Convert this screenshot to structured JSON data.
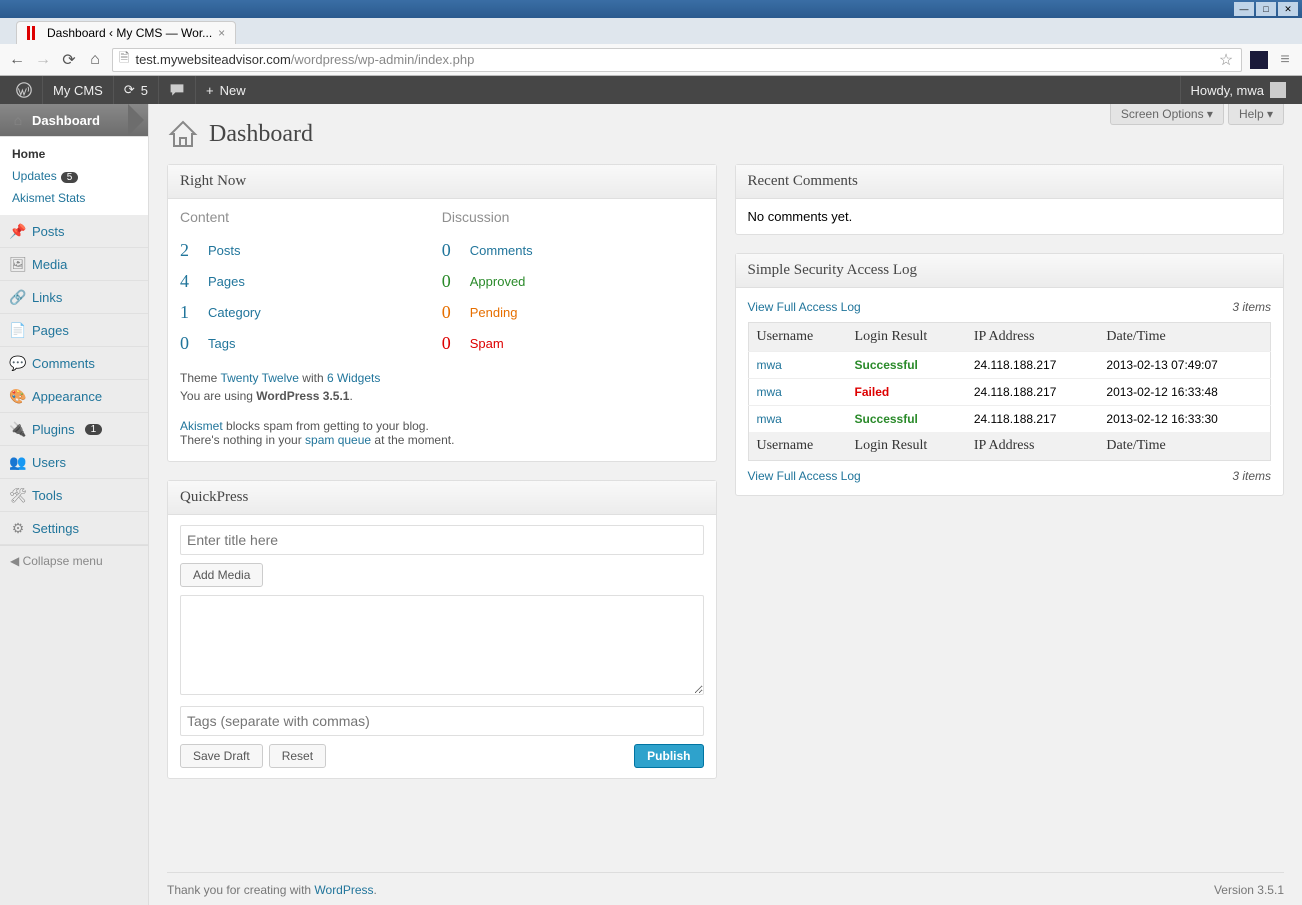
{
  "browser": {
    "tab_title": "Dashboard ‹ My CMS — Wor...",
    "url_domain": "test.mywebsiteadvisor.com",
    "url_path": "/wordpress/wp-admin/index.php"
  },
  "adminbar": {
    "site_name": "My CMS",
    "updates_count": "5",
    "new_label": "New",
    "howdy": "Howdy, mwa"
  },
  "sidebar": {
    "dashboard": "Dashboard",
    "home": "Home",
    "updates": "Updates",
    "updates_badge": "5",
    "akismet": "Akismet Stats",
    "posts": "Posts",
    "media": "Media",
    "links": "Links",
    "pages": "Pages",
    "comments": "Comments",
    "appearance": "Appearance",
    "plugins": "Plugins",
    "plugins_badge": "1",
    "users": "Users",
    "tools": "Tools",
    "settings": "Settings",
    "collapse": "Collapse menu"
  },
  "page": {
    "screen_options": "Screen Options",
    "help": "Help",
    "title": "Dashboard"
  },
  "right_now": {
    "title": "Right Now",
    "content_heading": "Content",
    "discussion_heading": "Discussion",
    "content": [
      {
        "count": "2",
        "label": "Posts"
      },
      {
        "count": "4",
        "label": "Pages"
      },
      {
        "count": "1",
        "label": "Category"
      },
      {
        "count": "0",
        "label": "Tags"
      }
    ],
    "discussion": [
      {
        "count": "0",
        "label": "Comments",
        "cls": ""
      },
      {
        "count": "0",
        "label": "Approved",
        "cls": "approved"
      },
      {
        "count": "0",
        "label": "Pending",
        "cls": "pending"
      },
      {
        "count": "0",
        "label": "Spam",
        "cls": "spam"
      }
    ],
    "theme_pre": "Theme ",
    "theme_name": "Twenty Twelve",
    "theme_mid": " with ",
    "theme_widgets": "6 Widgets",
    "wp_pre": "You are using ",
    "wp_ver": "WordPress 3.5.1",
    "wp_post": ".",
    "akismet_link": "Akismet",
    "akismet_rest": " blocks spam from getting to your blog.",
    "spam_pre": "There's nothing in your ",
    "spam_link": "spam queue",
    "spam_post": " at the moment."
  },
  "quickpress": {
    "title": "QuickPress",
    "title_placeholder": "Enter title here",
    "add_media": "Add Media",
    "tags_placeholder": "Tags (separate with commas)",
    "save_draft": "Save Draft",
    "reset": "Reset",
    "publish": "Publish"
  },
  "recent_comments": {
    "title": "Recent Comments",
    "empty": "No comments yet."
  },
  "access_log": {
    "title": "Simple Security Access Log",
    "view_full": "View Full Access Log",
    "items_text": "3 items",
    "headers": {
      "username": "Username",
      "result": "Login Result",
      "ip": "IP Address",
      "datetime": "Date/Time"
    },
    "rows": [
      {
        "user": "mwa",
        "result": "Successful",
        "cls": "succ",
        "ip": "24.118.188.217",
        "dt": "2013-02-13 07:49:07"
      },
      {
        "user": "mwa",
        "result": "Failed",
        "cls": "fail",
        "ip": "24.118.188.217",
        "dt": "2013-02-12 16:33:48"
      },
      {
        "user": "mwa",
        "result": "Successful",
        "cls": "succ",
        "ip": "24.118.188.217",
        "dt": "2013-02-12 16:33:30"
      }
    ]
  },
  "footer": {
    "thanks_pre": "Thank you for creating with ",
    "thanks_link": "WordPress",
    "thanks_post": ".",
    "version": "Version 3.5.1"
  }
}
